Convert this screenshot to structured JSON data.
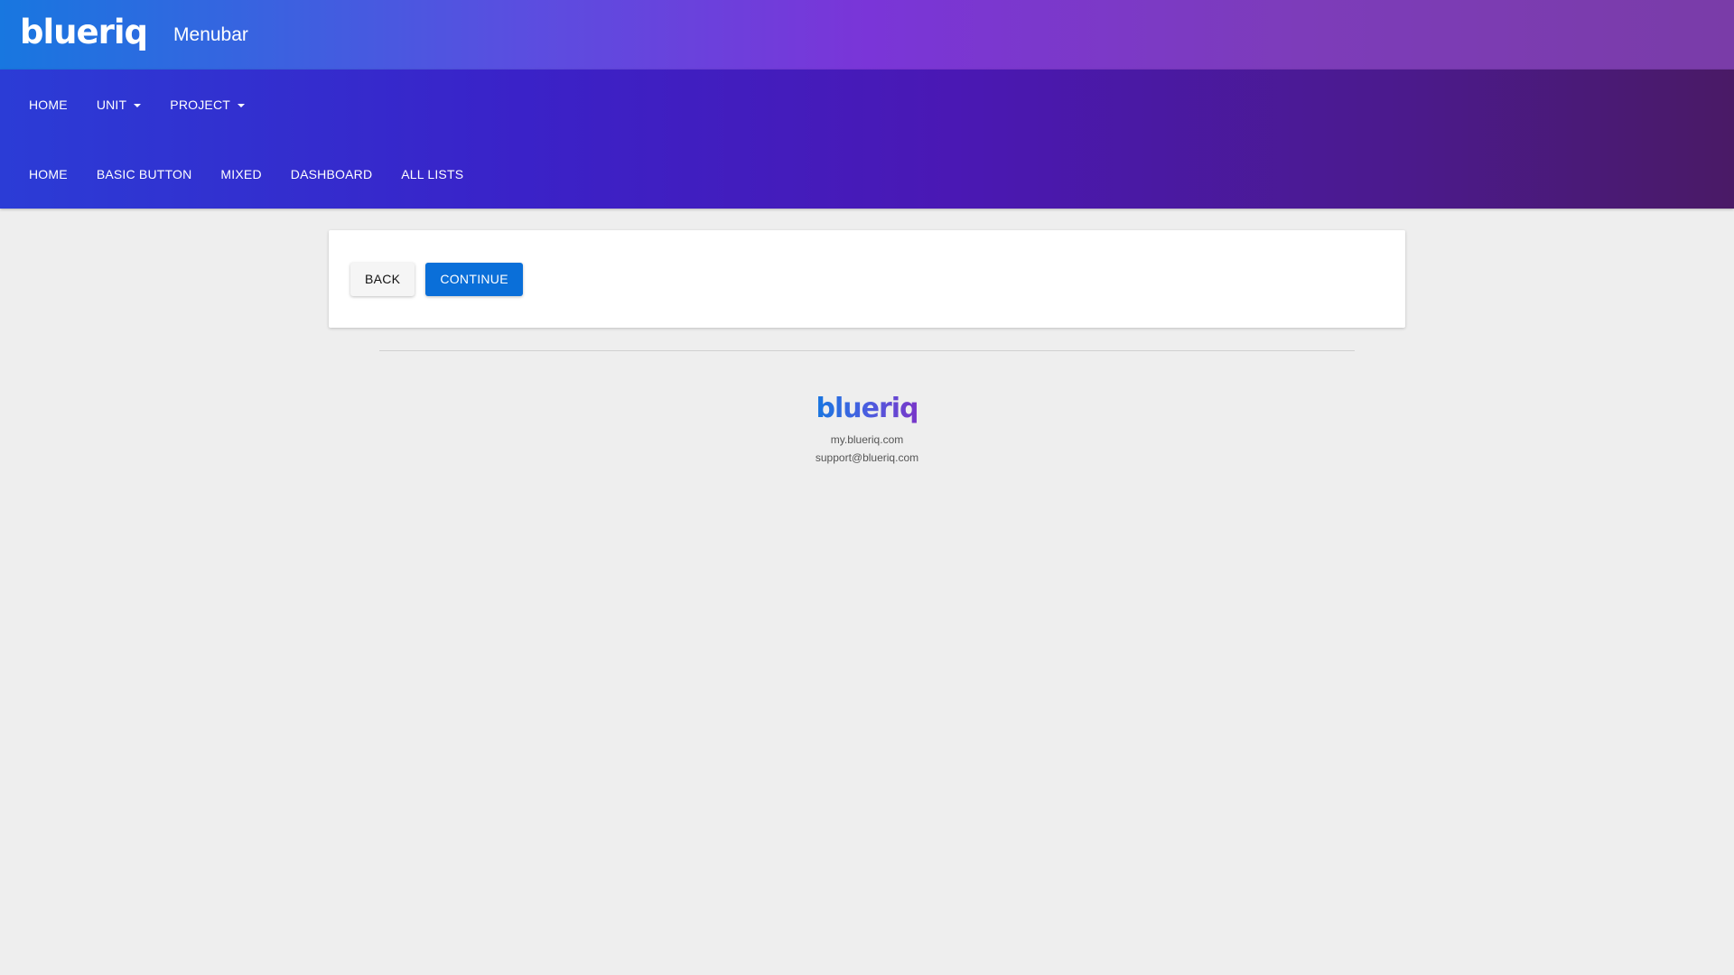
{
  "header": {
    "logo_text": "blueriq",
    "title": "Menubar",
    "colors": {
      "gradient_start": "#1877e0",
      "gradient_end": "#7a3ca8"
    }
  },
  "menubar": {
    "row1": [
      {
        "label": "HOME",
        "has_dropdown": false
      },
      {
        "label": "UNIT",
        "has_dropdown": true
      },
      {
        "label": "PROJECT",
        "has_dropdown": true
      }
    ],
    "row2": [
      {
        "label": "HOME"
      },
      {
        "label": "BASIC BUTTON"
      },
      {
        "label": "MIXED"
      },
      {
        "label": "DASHBOARD"
      },
      {
        "label": "ALL LISTS"
      }
    ]
  },
  "card": {
    "back_label": "BACK",
    "continue_label": "CONTINUE",
    "continue_color": "#0a6fd9"
  },
  "footer": {
    "logo_text": "blueriq",
    "site_link": "my.blueriq.com",
    "support_email": "support@blueriq.com"
  },
  "icons": {
    "dropdown": "caret-down-icon"
  }
}
